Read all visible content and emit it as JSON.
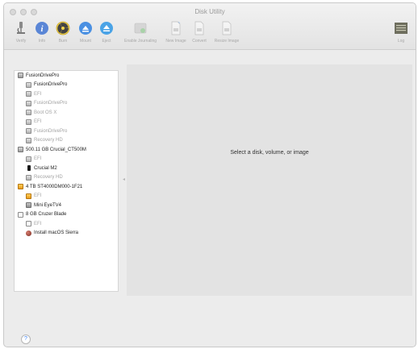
{
  "window": {
    "title": "Disk Utility"
  },
  "toolbar": {
    "verify": "Verify",
    "info": "Info",
    "burn": "Burn",
    "mount": "Mount",
    "eject": "Eject",
    "journaling": "Enable Journaling",
    "new_image": "New Image",
    "convert": "Convert",
    "resize_image": "Resize Image",
    "log": "Log"
  },
  "sidebar": {
    "items": [
      {
        "label": "FusionDrivePro",
        "icon": "hard-disk-icon",
        "dim": false
      },
      {
        "label": "FusionDrivePro",
        "icon": "volume-icon",
        "dim": false
      },
      {
        "label": "EFI",
        "icon": "volume-icon",
        "dim": true
      },
      {
        "label": "FusionDrivePro",
        "icon": "volume-icon",
        "dim": true
      },
      {
        "label": "Boot OS X",
        "icon": "volume-icon",
        "dim": true
      },
      {
        "label": "EFI",
        "icon": "volume-icon",
        "dim": true
      },
      {
        "label": "FusionDrivePro",
        "icon": "volume-icon",
        "dim": true
      },
      {
        "label": "Recovery HD",
        "icon": "volume-icon",
        "dim": true
      },
      {
        "label": "500.11 GB Crucial_CT500M",
        "icon": "hard-disk-icon",
        "dim": false
      },
      {
        "label": "EFI",
        "icon": "volume-icon",
        "dim": true
      },
      {
        "label": "Crucial M2",
        "icon": "m2-drive-icon",
        "dim": false
      },
      {
        "label": "Recovery HD",
        "icon": "volume-icon",
        "dim": true
      },
      {
        "label": "4 TB ST4000DM000-1F21",
        "icon": "external-disk-icon",
        "dim": false
      },
      {
        "label": "EFI",
        "icon": "external-volume-icon",
        "dim": true
      },
      {
        "label": "Mini EyeTV4",
        "icon": "tv-volume-icon",
        "dim": false
      },
      {
        "label": "8 GB Cruzer Blade",
        "icon": "usb-disk-icon",
        "dim": false
      },
      {
        "label": "EFI",
        "icon": "usb-volume-icon",
        "dim": true
      },
      {
        "label": "Install macOS Sierra",
        "icon": "sierra-installer-icon",
        "dim": false
      }
    ]
  },
  "main": {
    "placeholder": "Select a disk, volume, or image"
  },
  "help": {
    "label": "?"
  }
}
